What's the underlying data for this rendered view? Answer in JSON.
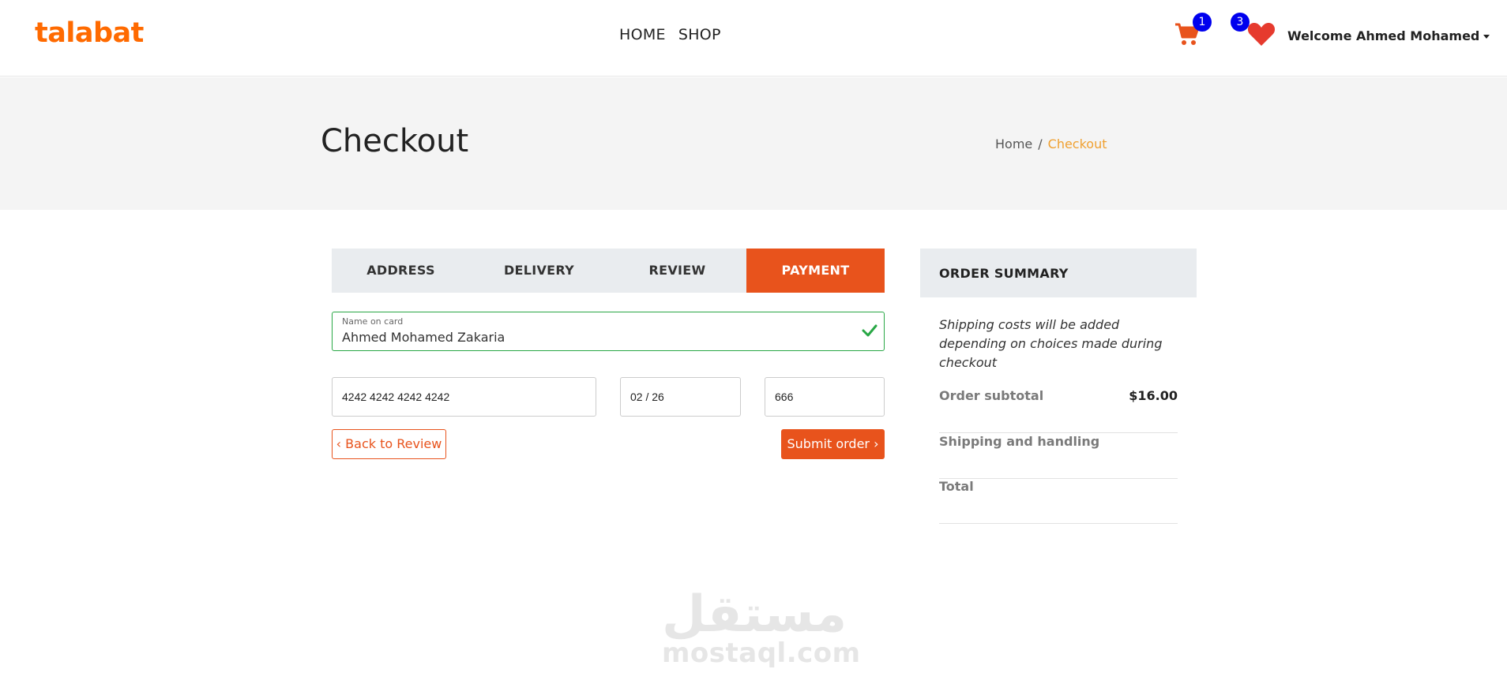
{
  "brand": {
    "logo": "talabat",
    "accent": "#e8531c",
    "logo_color": "#ff6a00"
  },
  "nav": {
    "links": [
      "HOME",
      "SHOP"
    ]
  },
  "header_icons": {
    "cart_count": "1",
    "wishlist_count": "3",
    "welcome": "Welcome Ahmed Mohamed",
    "cart_icon": "shopping-cart",
    "wishlist_icon": "heart"
  },
  "page": {
    "title": "Checkout",
    "breadcrumb": [
      "Home",
      "Checkout"
    ]
  },
  "steps": [
    "ADDRESS",
    "DELIVERY",
    "REVIEW",
    "PAYMENT"
  ],
  "active_step": "PAYMENT",
  "form": {
    "name_label": "Name on card",
    "name_value": "Ahmed Mohamed Zakaria",
    "card_number": "4242 4242 4242 4242",
    "expiry": "02 / 26",
    "cvc": "666",
    "back_label": "‹ Back to Review",
    "submit_label": "Submit order ›"
  },
  "summary": {
    "title": "ORDER SUMMARY",
    "note": "Shipping costs will be added depending on choices made during checkout",
    "rows": [
      {
        "label": "Order subtotal",
        "value": "$16.00"
      },
      {
        "label": "Shipping and handling",
        "value": ""
      },
      {
        "label": "Total",
        "value": ""
      }
    ]
  },
  "watermark": {
    "arabic": "مستقل",
    "latin": "mostaql.com"
  }
}
